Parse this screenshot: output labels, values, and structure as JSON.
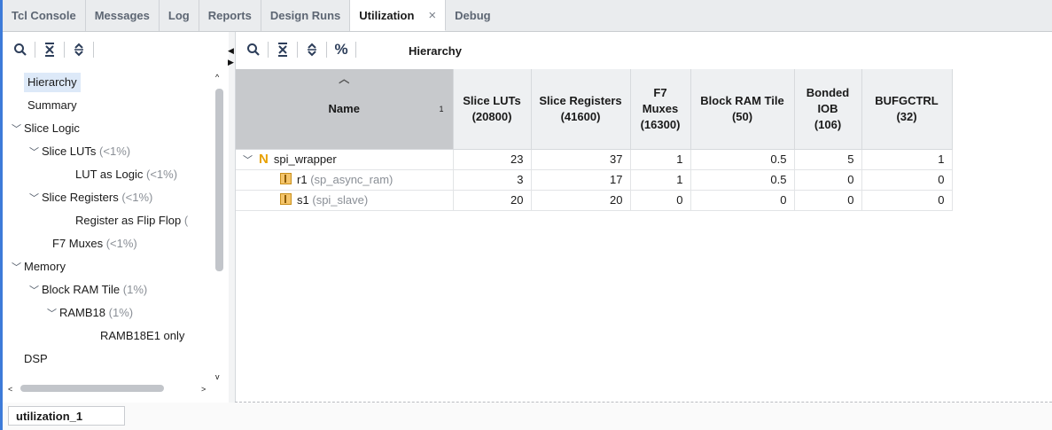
{
  "tabs": [
    {
      "label": "Tcl Console",
      "active": false
    },
    {
      "label": "Messages",
      "active": false
    },
    {
      "label": "Log",
      "active": false
    },
    {
      "label": "Reports",
      "active": false
    },
    {
      "label": "Design Runs",
      "active": false
    },
    {
      "label": "Utilization",
      "active": true,
      "closable": true
    },
    {
      "label": "Debug",
      "active": false
    }
  ],
  "tab_close_glyph": "×",
  "left_toolbar": {
    "icons": [
      "search-icon",
      "collapse-all-icon",
      "expand-all-icon"
    ]
  },
  "right_toolbar": {
    "icons": [
      "search-icon",
      "collapse-all-icon",
      "expand-all-icon",
      "percent-icon"
    ],
    "view_label": "Hierarchy"
  },
  "tree": [
    {
      "label": "Hierarchy",
      "pct": "",
      "selected": true
    },
    {
      "label": "Summary",
      "pct": ""
    },
    {
      "label": "Slice Logic",
      "pct": ""
    },
    {
      "label": "Slice LUTs",
      "pct": "(<1%)"
    },
    {
      "label": "LUT as Logic",
      "pct": "(<1%)"
    },
    {
      "label": "Slice Registers",
      "pct": "(<1%)"
    },
    {
      "label": "Register as Flip Flop",
      "pct": "("
    },
    {
      "label": "F7 Muxes",
      "pct": "(<1%)"
    },
    {
      "label": "Memory",
      "pct": ""
    },
    {
      "label": "Block RAM Tile",
      "pct": "(1%)"
    },
    {
      "label": "RAMB18",
      "pct": "(1%)"
    },
    {
      "label": "RAMB18E1 only",
      "pct": ""
    },
    {
      "label": "DSP",
      "pct": ""
    }
  ],
  "table": {
    "sort_marker": "1",
    "headers": [
      {
        "line1": "Name",
        "line2": "",
        "line3": ""
      },
      {
        "line1": "Slice LUTs",
        "line2": "(20800)",
        "line3": ""
      },
      {
        "line1": "Slice Registers",
        "line2": "(41600)",
        "line3": ""
      },
      {
        "line1": "F7",
        "line2": "Muxes",
        "line3": "(16300)"
      },
      {
        "line1": "Block RAM Tile",
        "line2": "(50)",
        "line3": ""
      },
      {
        "line1": "Bonded IOB",
        "line2": "(106)",
        "line3": ""
      },
      {
        "line1": "BUFGCTRL",
        "line2": "(32)",
        "line3": ""
      }
    ],
    "rows": [
      {
        "instance": "spi_wrapper",
        "module": "",
        "values": [
          "23",
          "37",
          "1",
          "0.5",
          "5",
          "1"
        ]
      },
      {
        "instance": "r1",
        "module": "(sp_async_ram)",
        "values": [
          "3",
          "17",
          "1",
          "0.5",
          "0",
          "0"
        ]
      },
      {
        "instance": "s1",
        "module": "(spi_slave)",
        "values": [
          "20",
          "20",
          "0",
          "0",
          "0",
          "0"
        ]
      }
    ]
  },
  "bottom_tab": {
    "label": "utilization_1"
  },
  "colors": {
    "accent": "#3d7bd9",
    "selection": "#dde9f8",
    "icon_gold": "#e8a100"
  }
}
